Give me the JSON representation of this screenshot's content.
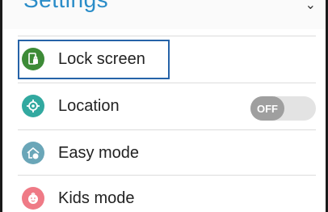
{
  "header": {
    "title": "Settings",
    "action_glyph": "⌄"
  },
  "items": [
    {
      "label": "Lock screen",
      "icon": "lock-screen-icon",
      "color": "#3d8b37"
    },
    {
      "label": "Location",
      "icon": "location-icon",
      "color": "#32a9a0",
      "toggle": {
        "state_label": "OFF",
        "on": false
      }
    },
    {
      "label": "Easy mode",
      "icon": "easy-mode-icon",
      "color": "#6aa6b8"
    },
    {
      "label": "Kids mode",
      "icon": "kids-mode-icon",
      "color": "#ef7a86"
    }
  ],
  "colors": {
    "accent": "#2a8cc8",
    "focus": "#2663a8",
    "toggle_off": "#9f9f9f"
  }
}
